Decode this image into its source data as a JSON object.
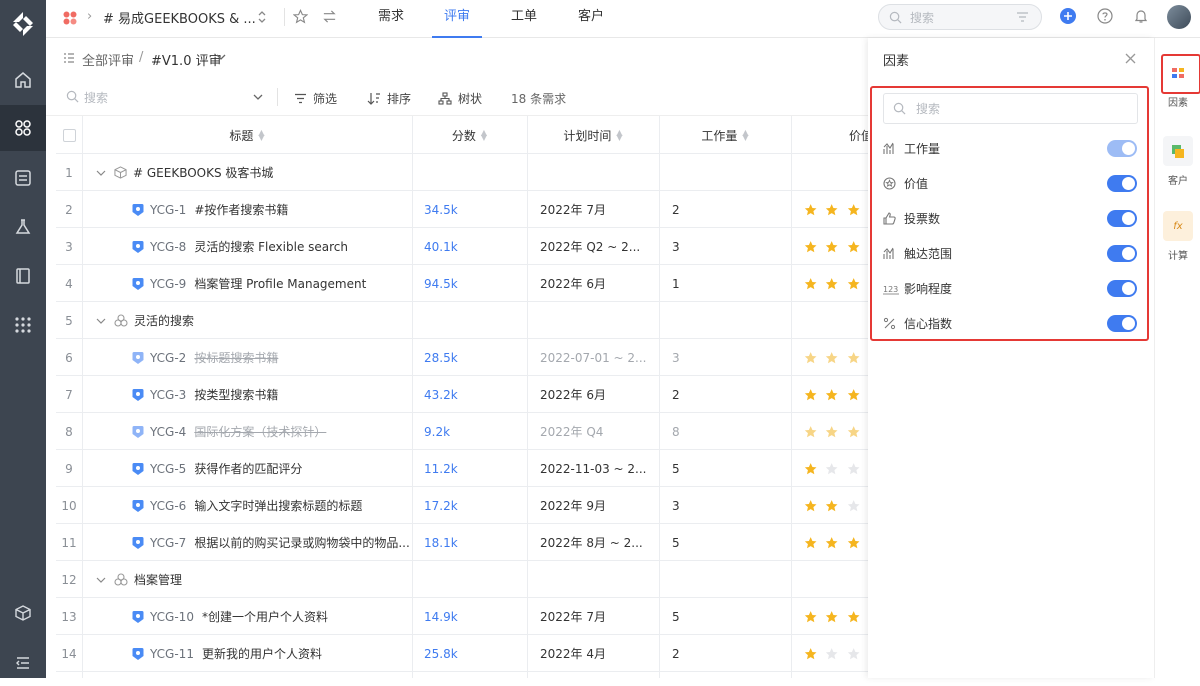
{
  "topbar": {
    "breadcrumb_title": "# 易成GEEKBOOKS & ...",
    "tabs": [
      {
        "label": "需求",
        "active": false
      },
      {
        "label": "评审",
        "active": true
      },
      {
        "label": "工单",
        "active": false
      },
      {
        "label": "客户",
        "active": false
      }
    ],
    "search_placeholder": "搜索"
  },
  "crumb": {
    "root": "全部评审",
    "sep": "/",
    "current": "#V1.0 评审"
  },
  "toolbar": {
    "search_placeholder": "搜索",
    "filter": "筛选",
    "sort": "排序",
    "tree": "树状",
    "count": "18 条需求"
  },
  "table": {
    "headers": {
      "title": "标题",
      "score": "分数",
      "plan": "计划时间",
      "workload": "工作量",
      "value": "价值"
    },
    "rows": [
      {
        "n": "1",
        "group": true,
        "icon": "cube",
        "title": "# GEEKBOOKS 极客书城"
      },
      {
        "n": "2",
        "key": "YCG-1",
        "title": "#按作者搜索书籍",
        "score": "34.5k",
        "plan": "2022年 7月",
        "work": "2",
        "stars": 3
      },
      {
        "n": "3",
        "key": "YCG-8",
        "title": "灵活的搜索 Flexible search",
        "score": "40.1k",
        "plan": "2022年 Q2 ~ 2...",
        "work": "3",
        "stars": 3
      },
      {
        "n": "4",
        "key": "YCG-9",
        "title": "档案管理 Profile Management",
        "score": "94.5k",
        "plan": "2022年 6月",
        "work": "1",
        "stars": 3
      },
      {
        "n": "5",
        "group": true,
        "icon": "circles",
        "title": "灵活的搜索"
      },
      {
        "n": "6",
        "key": "YCG-2",
        "title": "按标题搜索书籍",
        "score": "28.5k",
        "plan": "2022-07-01 ~ 2...",
        "work": "3",
        "stars": 3,
        "done": true
      },
      {
        "n": "7",
        "key": "YCG-3",
        "title": "按类型搜索书籍",
        "score": "43.2k",
        "plan": "2022年 6月",
        "work": "2",
        "stars": 3
      },
      {
        "n": "8",
        "key": "YCG-4",
        "title": "国际化方案（技术探针）",
        "score": "9.2k",
        "plan": "2022年 Q4",
        "work": "8",
        "stars": 3,
        "done": true
      },
      {
        "n": "9",
        "key": "YCG-5",
        "title": "获得作者的匹配评分",
        "score": "11.2k",
        "plan": "2022-11-03 ~ 2...",
        "work": "5",
        "stars": 1
      },
      {
        "n": "10",
        "key": "YCG-6",
        "title": "输入文字时弹出搜索标题的标题",
        "score": "17.2k",
        "plan": "2022年 9月",
        "work": "3",
        "stars": 2
      },
      {
        "n": "11",
        "key": "YCG-7",
        "title": "根据以前的购买记录或购物袋中的物品...",
        "score": "18.1k",
        "plan": "2022年 8月 ~ 2...",
        "work": "5",
        "stars": 3
      },
      {
        "n": "12",
        "group": true,
        "icon": "circles",
        "title": "档案管理"
      },
      {
        "n": "13",
        "key": "YCG-10",
        "title": "*创建一个用户个人资料",
        "score": "14.9k",
        "plan": "2022年 7月",
        "work": "5",
        "stars": 3
      },
      {
        "n": "14",
        "key": "YCG-11",
        "title": "更新我的用户个人资料",
        "score": "25.8k",
        "plan": "2022年 4月",
        "work": "2",
        "stars": 1
      }
    ]
  },
  "panel": {
    "title": "因素",
    "search_placeholder": "搜索",
    "factors": [
      {
        "label": "工作量",
        "icon": "chart-icon",
        "on": true,
        "light": true
      },
      {
        "label": "价值",
        "icon": "star-circle-icon",
        "on": true
      },
      {
        "label": "投票数",
        "icon": "thumb-icon",
        "on": true
      },
      {
        "label": "触达范围",
        "icon": "chart-icon",
        "on": true
      },
      {
        "label": "影响程度",
        "icon": "number-icon",
        "on": true
      },
      {
        "label": "信心指数",
        "icon": "percent-icon",
        "on": true
      }
    ]
  },
  "rightbar": {
    "items": [
      "因素",
      "客户",
      "计算"
    ]
  },
  "colors": {
    "accent": "#3f7bf0",
    "rail": "#3d4550",
    "star": "#f5b51f",
    "highlight": "#e53935"
  }
}
